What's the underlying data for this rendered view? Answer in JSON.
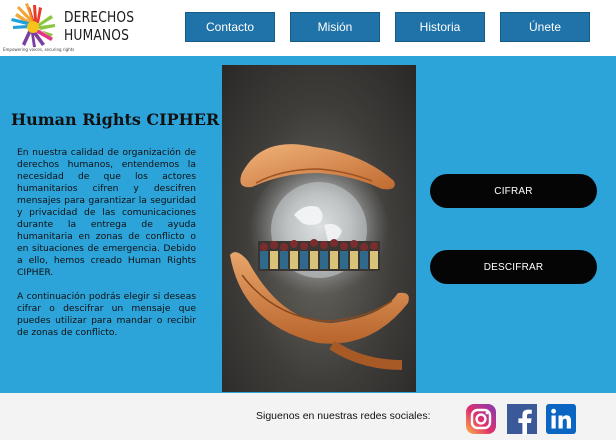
{
  "header": {
    "logo_line1": "DERECHOS",
    "logo_line2": "HUMANOS",
    "tagline": "Empowering voices, securing rights",
    "nav": [
      "Contacto",
      "Misión",
      "Historia",
      "Únete"
    ]
  },
  "main": {
    "title": "Human Rights CIPHER",
    "paragraph1": "En nuestra calidad de organización de derechos humanos, entendemos la necesidad de que los actores humanitarios cifren y descifren mensajes para garantizar la seguridad y privacidad de las comunicaciones durante la entrega de ayuda humanitaria en zonas de conflicto o en situaciones de emergencia. Debido a ello, hemos creado Human Rights CIPHER.",
    "paragraph2": "A continuación podrás elegir si deseas cifrar o descifrar un mensaje que puedes utilizar para mandar o recibir de zonas de conflicto.",
    "cipher_button": "CIFRAR",
    "decipher_button": "DESCIFRAR"
  },
  "footer": {
    "text": "Siguenos en nuestras redes sociales:",
    "social": [
      "instagram-icon",
      "facebook-icon",
      "linkedin-icon"
    ]
  },
  "colors": {
    "main_bg": "#2ca3d9",
    "nav_bg": "#1f73a8",
    "button_bg": "#050505",
    "footer_bg": "#f3f3f3"
  }
}
